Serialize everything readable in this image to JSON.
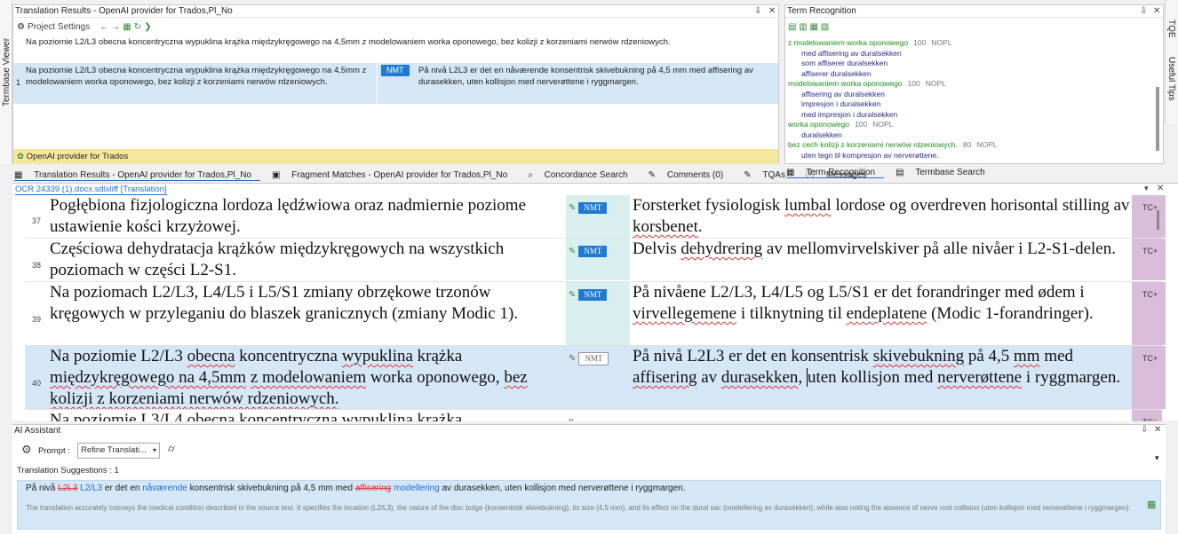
{
  "left_sidebar": {
    "termbase_viewer": "Termbase Viewer"
  },
  "right_sidebar": {
    "tqe": "TQE",
    "useful_tips": "Useful Tips"
  },
  "translation_results": {
    "title": "Translation Results - OpenAI provider for Trados,Pl_No",
    "project_settings": "Project Settings",
    "source_sentence": "Na poziomie L2/L3 obecna koncentryczna wypuklina krążka międzykręgowego na 4,5mm z modelowaniem worka oponowego, bez kolizji z korzeniami nerwów rdzeniowych.",
    "row_number": "1",
    "row_source": "Na poziomie L2/L3 obecna koncentryczna wypuklina krążka międzykręgowego na 4,5mm z modelowaniem worka oponowego, bez kolizji z korzeniami nerwów rdzeniowych.",
    "row_badge": "NMT",
    "row_target": "På nivå L2L3 er det en nåværende konsentrisk skivebukning på 4,5 mm med affisering av durasekken, uten kollisjon med nerverøttene i ryggmargen.",
    "provider": "OpenAI provider for Trados"
  },
  "tabs_left": [
    "Translation Results - OpenAI provider for Trados,Pl_No",
    "Fragment Matches - OpenAI provider for Trados,Pl_No",
    "Concordance Search",
    "Comments (0)",
    "TQAs",
    "Messages"
  ],
  "term_recognition": {
    "title": "Term Recognition",
    "terms": [
      {
        "text": "z modelowaniem worka oponowego",
        "score": "100",
        "tag": "NOPL",
        "kind": "source"
      },
      {
        "text": "med affisering av duralsekken",
        "kind": "target"
      },
      {
        "text": "som affiserer duralsekken",
        "kind": "target"
      },
      {
        "text": "affiserer duralsekken",
        "kind": "target"
      },
      {
        "text": "modelowaniem worka oponowego",
        "score": "100",
        "tag": "NOPL",
        "kind": "source"
      },
      {
        "text": "affisering av duralsekken",
        "kind": "target"
      },
      {
        "text": "impresjon i duralsekken",
        "kind": "target"
      },
      {
        "text": "med impresjon i duralsekken",
        "kind": "target"
      },
      {
        "text": "worka oponowego",
        "score": "100",
        "tag": "NOPL",
        "kind": "source"
      },
      {
        "text": "duralsekken",
        "kind": "target"
      },
      {
        "text": "bez cech kolizji z korzeniami nerwów rdzeniowych.",
        "score": "80",
        "tag": "NOPL",
        "kind": "source"
      },
      {
        "text": "uten tegn til kompresjon av nerverøttene.",
        "kind": "target"
      }
    ],
    "tab_active": "Term Recognition",
    "tab_other": "Termbase Search"
  },
  "editor": {
    "file_tab": "OCR 24339 (1).docx.sdlxliff [Translation]",
    "segments": [
      {
        "num": "37",
        "source": "Pogłębiona fizjologiczna lordoza lędźwiowa oraz nadmiernie poziome ustawienie kości krzyżowej.",
        "badge": "NMT",
        "target": "Forsterket fysiologisk lumbal lordose og overdreven horisontal stilling av korsbenet.",
        "tc": "TC+"
      },
      {
        "num": "38",
        "source": "Częściowa dehydratacja krążków międzykręgowych na wszystkich poziomach w części L2-S1.",
        "badge": "NMT",
        "target": "Delvis dehydrering av mellomvirvelskiver på alle nivåer i L2-S1-delen.",
        "tc": "TC+"
      },
      {
        "num": "39",
        "source": "Na poziomach L2/L3, L4/L5 i L5/S1 zmiany obrzękowe trzonów kręgowych w przyleganiu do blaszek granicznych (zmiany Modic 1).",
        "badge": "NMT",
        "target": "På nivåene L2/L3, L4/L5 og L5/S1 er det forandringer med ødem i virvellegemene i tilknytning til endeplatene (Modic 1-forandringer).",
        "tc": "TC+"
      },
      {
        "num": "40",
        "source": "Na poziomie L2/L3 obecna koncentryczna wypuklina krążka międzykręgowego na 4,5mm z modelowaniem worka oponowego, bez kolizji z korzeniami nerwów rdzeniowych.",
        "badge": "NMT",
        "target": "På nivå L2L3 er det en konsentrisk skivebukning på 4,5 mm med affisering av durasekken, uten kollisjon med nerverøttene i ryggmargen.",
        "tc": "TC+"
      },
      {
        "num": "",
        "source": "Na poziomie L3/L4 obecna koncentryczna wypuklina krążka",
        "badge": "",
        "target": "",
        "tc": "TC+"
      }
    ]
  },
  "ai_assistant": {
    "title": "AI Assistant",
    "prompt_label": "Prompt :",
    "prompt_value": "Refine Translati...",
    "suggestions_label": "Translation Suggestions : 1",
    "suggestion": {
      "p1": "På nivå ",
      "del1": "L2L3",
      "ins1": " L2/L3",
      "p2": " er det en ",
      "ins2": "nåværende",
      "p3": " konsentrisk skivebukning på 4,5 mm med ",
      "del2": "affisering",
      "ins3": " modellering",
      "p4": " av durasekken, uten kollisjon med nerverøttene i ryggmargen."
    },
    "explanation": "The translation accurately conveys the medical condition described in the source text. It specifies the location (L2/L3), the nature of the disc bulge (konsentrisk skivebukning), its size (4,5 mm), and its effect on the dural sac (modellering av durasekken), while also noting the absence of nerve root collision (uten kollisjon med nerverøttene i ryggmargen)."
  },
  "colors": {
    "accent": "#1f7bd2",
    "match_bg": "#d5e6f7",
    "tc_bg": "#d9bcd9",
    "mid_bg": "#d9efef",
    "provider_bg": "#f5e79e"
  }
}
